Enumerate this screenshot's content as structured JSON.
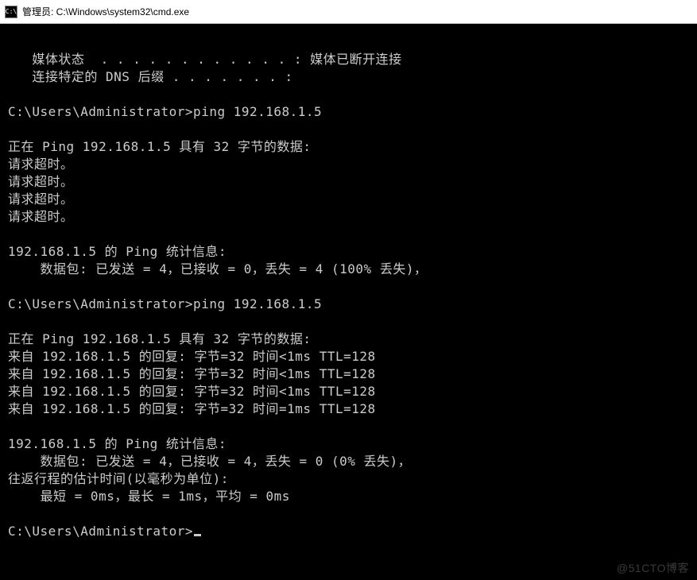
{
  "titlebar": {
    "icon_label": "C:\\",
    "title": "管理员: C:\\Windows\\system32\\cmd.exe"
  },
  "terminal": {
    "lines": [
      "",
      "   媒体状态  . . . . . . . . . . . . : 媒体已断开连接",
      "   连接特定的 DNS 后缀 . . . . . . . :",
      "",
      "C:\\Users\\Administrator>ping 192.168.1.5",
      "",
      "正在 Ping 192.168.1.5 具有 32 字节的数据:",
      "请求超时。",
      "请求超时。",
      "请求超时。",
      "请求超时。",
      "",
      "192.168.1.5 的 Ping 统计信息:",
      "    数据包: 已发送 = 4，已接收 = 0，丢失 = 4 (100% 丢失)，",
      "",
      "C:\\Users\\Administrator>ping 192.168.1.5",
      "",
      "正在 Ping 192.168.1.5 具有 32 字节的数据:",
      "来自 192.168.1.5 的回复: 字节=32 时间<1ms TTL=128",
      "来自 192.168.1.5 的回复: 字节=32 时间<1ms TTL=128",
      "来自 192.168.1.5 的回复: 字节=32 时间<1ms TTL=128",
      "来自 192.168.1.5 的回复: 字节=32 时间=1ms TTL=128",
      "",
      "192.168.1.5 的 Ping 统计信息:",
      "    数据包: 已发送 = 4，已接收 = 4，丢失 = 0 (0% 丢失)，",
      "往返行程的估计时间(以毫秒为单位):",
      "    最短 = 0ms，最长 = 1ms，平均 = 0ms",
      "",
      "C:\\Users\\Administrator>"
    ],
    "cursor_on_last": true
  },
  "watermark": "@51CTO博客"
}
